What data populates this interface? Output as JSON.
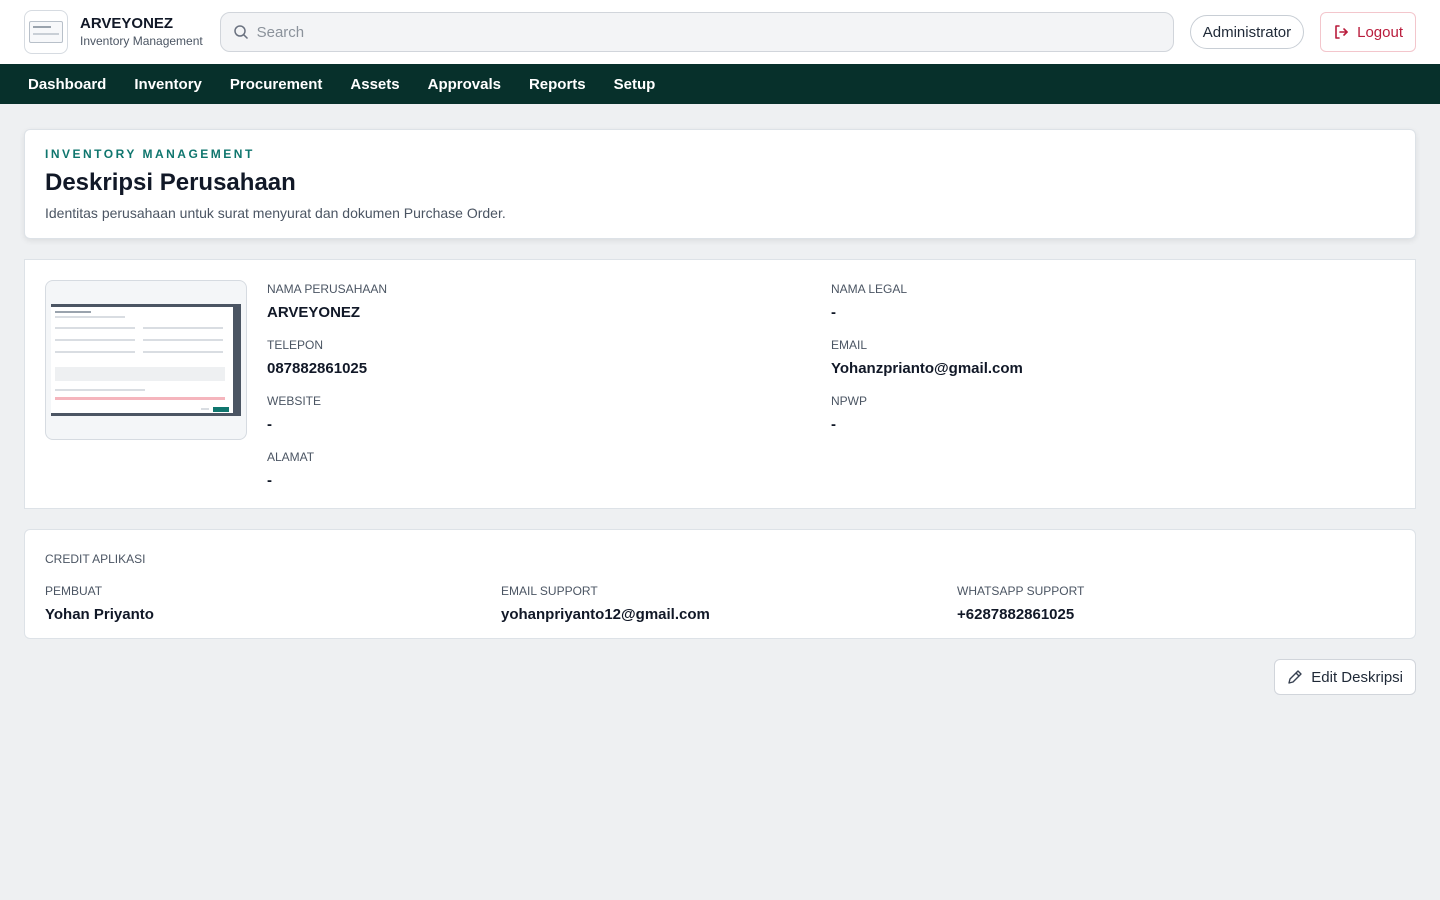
{
  "app": {
    "name": "ARVEYONEZ",
    "subtitle": "Inventory Management"
  },
  "search": {
    "placeholder": "Search"
  },
  "user": {
    "role_label": "Administrator",
    "logout_label": "Logout"
  },
  "nav": {
    "items": [
      {
        "label": "Dashboard"
      },
      {
        "label": "Inventory"
      },
      {
        "label": "Procurement"
      },
      {
        "label": "Assets"
      },
      {
        "label": "Approvals"
      },
      {
        "label": "Reports"
      },
      {
        "label": "Setup"
      }
    ]
  },
  "page": {
    "eyebrow": "INVENTORY MANAGEMENT",
    "title": "Deskripsi Perusahaan",
    "subtitle": "Identitas perusahaan untuk surat menyurat dan dokumen Purchase Order."
  },
  "company": {
    "fields": [
      {
        "label": "NAMA PERUSAHAAN",
        "value": "ARVEYONEZ"
      },
      {
        "label": "NAMA LEGAL",
        "value": "-"
      },
      {
        "label": "TELEPON",
        "value": "087882861025"
      },
      {
        "label": "EMAIL",
        "value": "Yohanzprianto@gmail.com"
      },
      {
        "label": "WEBSITE",
        "value": "-"
      },
      {
        "label": "NPWP",
        "value": "-"
      },
      {
        "label": "ALAMAT",
        "value": "-"
      }
    ]
  },
  "credit": {
    "title": "CREDIT APLIKASI",
    "fields": [
      {
        "label": "PEMBUAT",
        "value": "Yohan Priyanto"
      },
      {
        "label": "EMAIL SUPPORT",
        "value": "yohanpriyanto12@gmail.com"
      },
      {
        "label": "WHATSAPP SUPPORT",
        "value": "+6287882861025"
      }
    ]
  },
  "actions": {
    "edit_label": "Edit Deskripsi"
  },
  "colors": {
    "nav_bg": "#07302b",
    "accent": "#0f766e",
    "logout": "#b91c3c",
    "page_bg": "#eef0f2"
  },
  "icons": {
    "search": "search-icon",
    "logout": "logout-icon",
    "edit": "pencil-icon"
  }
}
